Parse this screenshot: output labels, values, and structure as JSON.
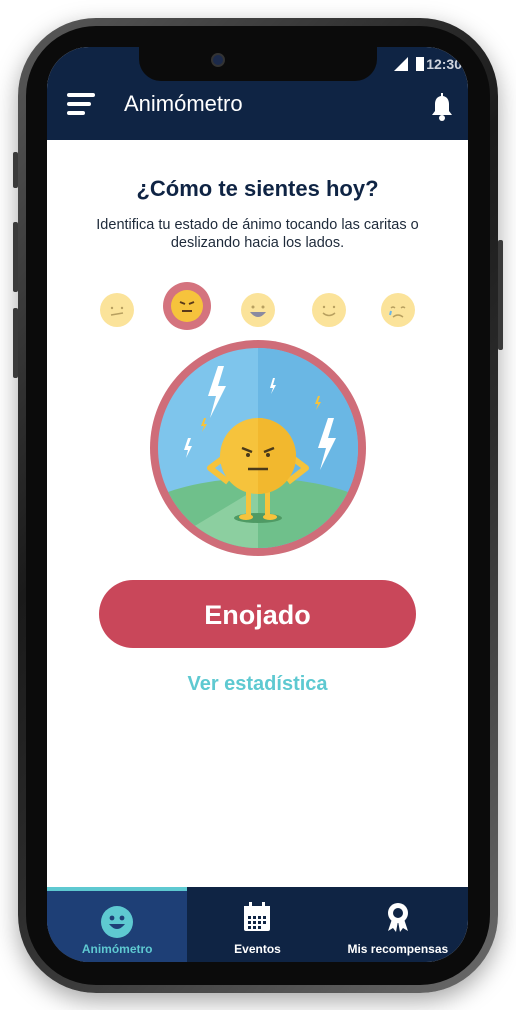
{
  "status_bar": {
    "time": "12:30"
  },
  "app_bar": {
    "title": "Animómetro",
    "menu_icon": "hamburger-menu-icon",
    "notification_icon": "bell-icon"
  },
  "main": {
    "question": "¿Cómo te sientes hoy?",
    "instructions": "Identifica tu estado de ánimo tocando las caritas o deslizando hacia los lados.",
    "moods": [
      {
        "name": "neutral",
        "icon": "neutral-face-icon",
        "selected": false
      },
      {
        "name": "angry",
        "icon": "angry-face-icon",
        "selected": true
      },
      {
        "name": "grinning",
        "icon": "grinning-face-icon",
        "selected": false
      },
      {
        "name": "happy",
        "icon": "smiling-face-icon",
        "selected": false
      },
      {
        "name": "sad",
        "icon": "crying-face-icon",
        "selected": false
      }
    ],
    "selected_mood_label": "Enojado",
    "stats_link": "Ver estadística"
  },
  "tabs": [
    {
      "label": "Animómetro",
      "icon": "smiley-icon",
      "active": true
    },
    {
      "label": "Eventos",
      "icon": "calendar-icon",
      "active": false
    },
    {
      "label": "Mis recompensas",
      "icon": "award-ribbon-icon",
      "active": false
    }
  ],
  "colors": {
    "navy": "#0f2444",
    "active_tab": "#1e3f76",
    "accent_teal": "#5ec9d1",
    "mood_red": "#c9475a",
    "face_yellow": "#fbe39a"
  }
}
